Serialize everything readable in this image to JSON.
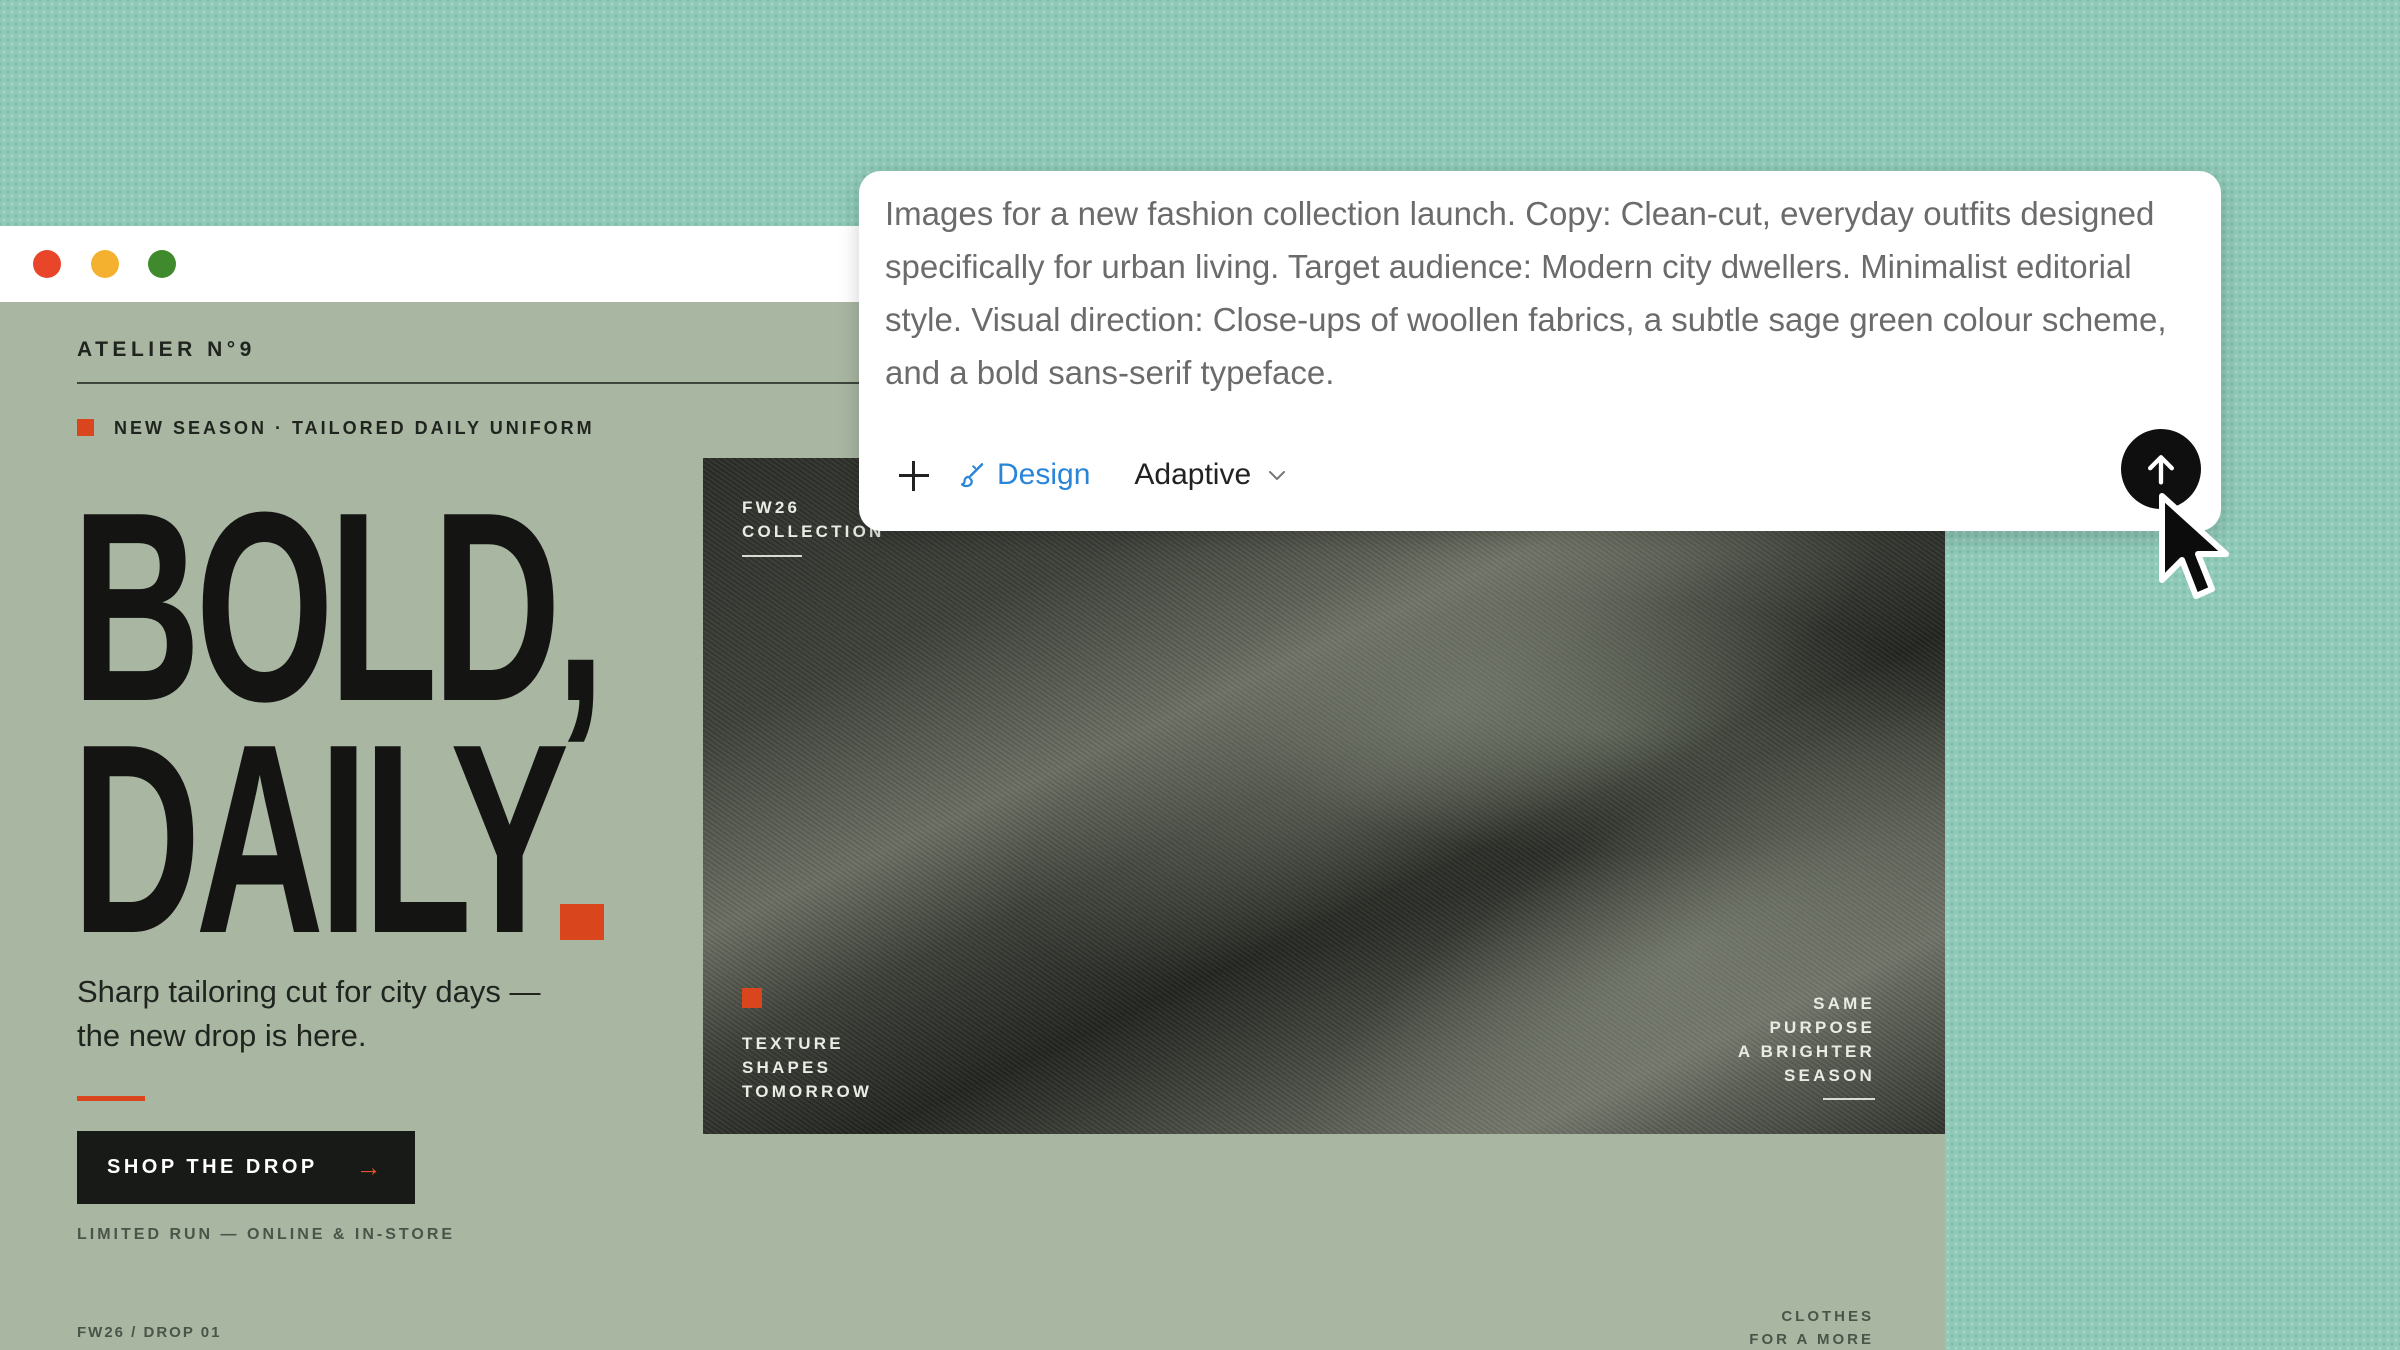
{
  "window": {
    "traffic_lights": [
      "#e8452b",
      "#f4b02f",
      "#3f8a2c"
    ]
  },
  "page": {
    "brand": "ATELIER N°9",
    "season_tag": "NEW SEASON · TAILORED DAILY UNIFORM",
    "headline_line1": "BOLD,",
    "headline_line2": "DAILY",
    "subcopy": "Sharp tailoring cut for city days — the new drop is here.",
    "cta_label": "SHOP THE DROP",
    "cta_arrow": "→",
    "limited_run": "LIMITED RUN — ONLINE & IN-STORE",
    "drop_label": "FW26 / DROP 01",
    "clothes_line1": "CLOTHES",
    "clothes_line2": "FOR A MORE",
    "accent_color": "#d9461e"
  },
  "fabric_image": {
    "collection_line1": "FW26",
    "collection_line2": "COLLECTION",
    "texture_line1": "TEXTURE",
    "texture_line2": "SHAPES",
    "texture_line3": "TOMORROW",
    "same_line1": "SAME",
    "same_line2": "PURPOSE",
    "same_line3": "A BRIGHTER",
    "same_line4": "SEASON"
  },
  "prompt": {
    "text": "Images for a new fashion collection launch. Copy: Clean-cut, everyday outfits designed specifically for urban living. Target audience: Modern city dwellers. Minimalist editorial style. Visual direction: Close-ups of woollen fabrics, a subtle sage green colour scheme, and a bold sans-serif typeface.",
    "add_icon": "plus-icon",
    "mode_label": "Design",
    "mode_icon": "brush-icon",
    "mode_color": "#2a84d8",
    "model_label": "Adaptive",
    "send_icon": "arrow-up-icon"
  }
}
